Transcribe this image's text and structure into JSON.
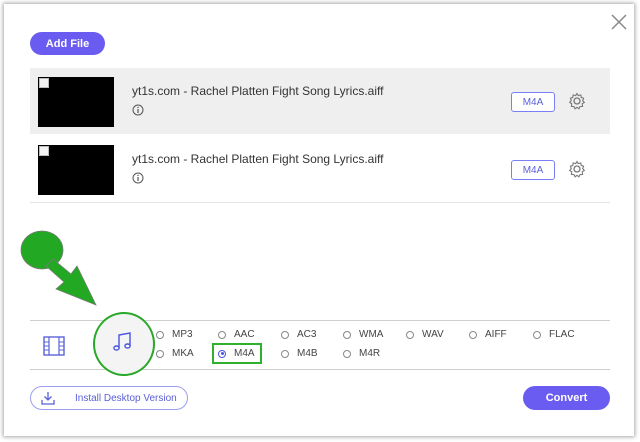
{
  "toolbar": {
    "add_file_label": "Add File"
  },
  "files": [
    {
      "name": "yt1s.com - Rachel Platten Fight Song Lyrics.aiff",
      "format": "M4A"
    },
    {
      "name": "yt1s.com - Rachel Platten Fight Song Lyrics.aiff",
      "format": "M4A"
    }
  ],
  "formats": {
    "row1": [
      "MP3",
      "AAC",
      "AC3",
      "WMA",
      "WAV",
      "AIFF",
      "FLAC"
    ],
    "row2": [
      "MKA",
      "M4A",
      "M4B",
      "M4R"
    ],
    "selected": "M4A"
  },
  "footer": {
    "install_label": "Install Desktop Version",
    "convert_label": "Convert"
  },
  "colors": {
    "accent": "#6a5cf0",
    "annotation_green": "#2aa82a"
  },
  "icons": [
    "close-icon",
    "info-icon",
    "gear-icon",
    "film-icon",
    "music-note-icon",
    "download-icon",
    "annotation-circle",
    "annotation-arrow"
  ]
}
